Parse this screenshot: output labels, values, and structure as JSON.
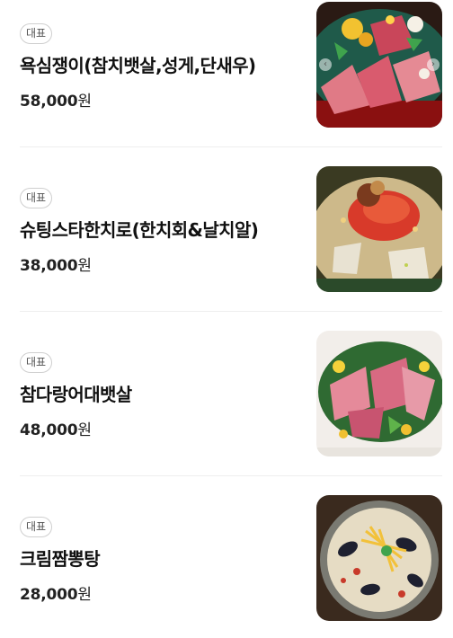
{
  "menu": {
    "items": [
      {
        "badge": "대표",
        "name": "욕심쟁이(참치뱃살,성게,단새우)",
        "price": "58,000",
        "currency": "원",
        "photo": "tuna-platter-photo"
      },
      {
        "badge": "대표",
        "name": "슈팅스타한치로(한치회&날치알)",
        "price": "38,000",
        "currency": "원",
        "photo": "squid-roe-photo"
      },
      {
        "badge": "대표",
        "name": "참다랑어대뱃살",
        "price": "48,000",
        "currency": "원",
        "photo": "bluefin-belly-photo"
      },
      {
        "badge": "대표",
        "name": "크림짬뽕탕",
        "price": "28,000",
        "currency": "원",
        "photo": "cream-jjamppong-photo"
      }
    ],
    "carousel": {
      "prev_icon": "chevron-left-icon",
      "next_icon": "chevron-right-icon"
    }
  }
}
